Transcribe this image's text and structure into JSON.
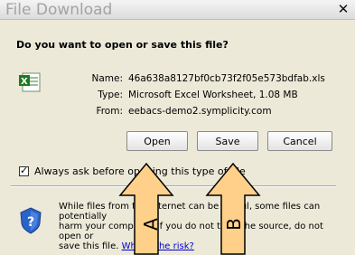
{
  "window": {
    "title": "File Download"
  },
  "question": "Do you want to open or save this file?",
  "file": {
    "name_label": "Name:",
    "name": "46a638a8127bf0cb73f2f05e573bdfab.xls",
    "type_label": "Type:",
    "type": "Microsoft Excel Worksheet, 1.08 MB",
    "from_label": "From:",
    "from": "eebacs-demo2.symplicity.com"
  },
  "buttons": {
    "open": "Open",
    "save": "Save",
    "cancel": "Cancel"
  },
  "checkbox": {
    "label": "Always ask before opening this type of file",
    "checked": true
  },
  "warning": {
    "text_line1": "While files from the Internet can be useful, some files can potentially",
    "text_line2": "harm your computer. If you do not trust the source, do not open or",
    "text_line3": "save this file.",
    "link": "What's the risk?"
  },
  "annotations": {
    "arrow_a": "A",
    "arrow_b": "B",
    "arrow_color": "#ffd08a"
  },
  "icons": {
    "file": "excel-file-icon",
    "warning": "security-shield-icon",
    "close": "close-icon"
  }
}
